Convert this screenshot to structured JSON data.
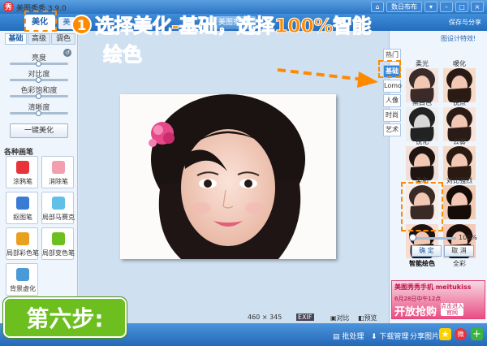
{
  "app": {
    "title": "美图秀秀 3.9.0"
  },
  "window": {
    "home_icon": "home-icon",
    "shop_label": "数日布布",
    "controls": [
      "▾",
      "–",
      "□",
      "×"
    ]
  },
  "toolbar": {
    "beautify": "美化",
    "second": "美",
    "third": "美图秀秀",
    "save_share": "保存与分享"
  },
  "left_panel": {
    "tabs": [
      "基础",
      "高级",
      "调色"
    ],
    "sliders": [
      {
        "label": "亮度",
        "value": 0.5
      },
      {
        "label": "对比度",
        "value": 0.5
      },
      {
        "label": "色彩饱和度",
        "value": 0.5
      },
      {
        "label": "清晰度",
        "value": 0.5
      }
    ],
    "oneclick": "一键美化",
    "brushes_title": "各种画笔",
    "brushes": [
      {
        "label": "涂鸦笔",
        "color": "#e8333a"
      },
      {
        "label": "消除笔",
        "color": "#f2a0b0"
      },
      {
        "label": "抠图笔",
        "color": "#3a7cd4"
      },
      {
        "label": "局部马赛克",
        "color": "#5fc1e8"
      },
      {
        "label": "局部彩色笔",
        "color": "#e8a020"
      },
      {
        "label": "局部变色笔",
        "color": "#6cbf1e"
      },
      {
        "label": "背景虚化",
        "color": "#4a9ad8"
      }
    ]
  },
  "canvas": {
    "size_info": "460 × 345",
    "fit": "EXIF",
    "compare": "对比",
    "preview": "预览"
  },
  "right_panel": {
    "design_link": "图设计特效!",
    "categories": [
      "热门",
      "基础",
      "Lomo",
      "人像",
      "时尚",
      "艺术"
    ],
    "effects": [
      "柔光",
      "暖化",
      "黑白色",
      "锐点",
      "锐化",
      "去雾",
      "柔和",
      "对比强烈",
      "智能绘色",
      "全彩"
    ],
    "percent": "100%",
    "ok": "确 定",
    "cancel": "取 消"
  },
  "ad": {
    "line1": "美图秀秀手机 meitukiss",
    "date": "6月28日中午12点",
    "big": "开放抢购",
    "btn": "点击进入官网"
  },
  "statusbar": {
    "batch": "批处理",
    "download": "下载管理",
    "share": "分享图片"
  },
  "overlay": {
    "step_num": "1",
    "instruction_1": "选择美化-基础，选择100%智能",
    "instruction_2": "绘色",
    "step_label": "第六步:"
  }
}
